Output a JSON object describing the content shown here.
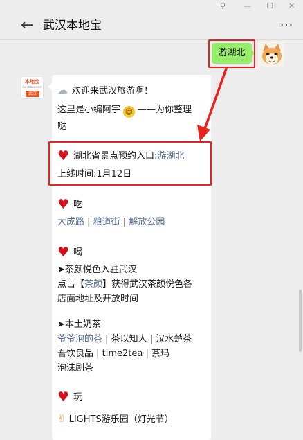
{
  "window": {
    "pin_icon": "pin-icon",
    "minimize_icon": "minimize-icon",
    "maximize_icon": "maximize-icon",
    "close_icon": "close-icon",
    "pin": "⚲",
    "minimize": "—",
    "maximize": "☐",
    "close": "✕"
  },
  "header": {
    "back": "←",
    "title": "武汉本地宝",
    "more": "···"
  },
  "user_message": {
    "text": "游湖北"
  },
  "bot": {
    "avatar_logo": "本地宝",
    "avatar_site": "bendibao.com",
    "avatar_city": "武汉"
  },
  "message": {
    "welcome": "欢迎来武汉旅游啊！",
    "intro_a": "这里是小编阿宇",
    "intro_b": "——为你整理",
    "intro_c": "哒",
    "booking_prefix": "湖北省景点预约入口:",
    "booking_link": "游湖北",
    "online_time": "上线时间:1月12日",
    "eat_title": "吃",
    "eat_links": [
      "大成路",
      "粮道街",
      "解放公园"
    ],
    "drink_title": "喝",
    "tea_title": "➤茶颜悦色入驻武汉",
    "tea_desc_a": "点击【",
    "tea_desc_link": "茶颜",
    "tea_desc_b": "】获得武汉茶颜悦色各",
    "tea_desc_c": "店面地址及开放时间",
    "milk_title": "➤本土奶茶",
    "milk_link": "爷爷泡的茶",
    "milk_line1_rest": " | 茶以知人 | 汉水楚茶",
    "milk_line2": "吾饮良品 | time2tea | 茶玛",
    "milk_line3": "泡沫剧茶",
    "play_title": "玩",
    "lights": "LIGHTS游乐园（灯光节）"
  },
  "colors": {
    "accent_green": "#95ec69",
    "highlight_red": "#e8221c",
    "link_blue": "#576b95",
    "heart_red": "#d5121c"
  }
}
